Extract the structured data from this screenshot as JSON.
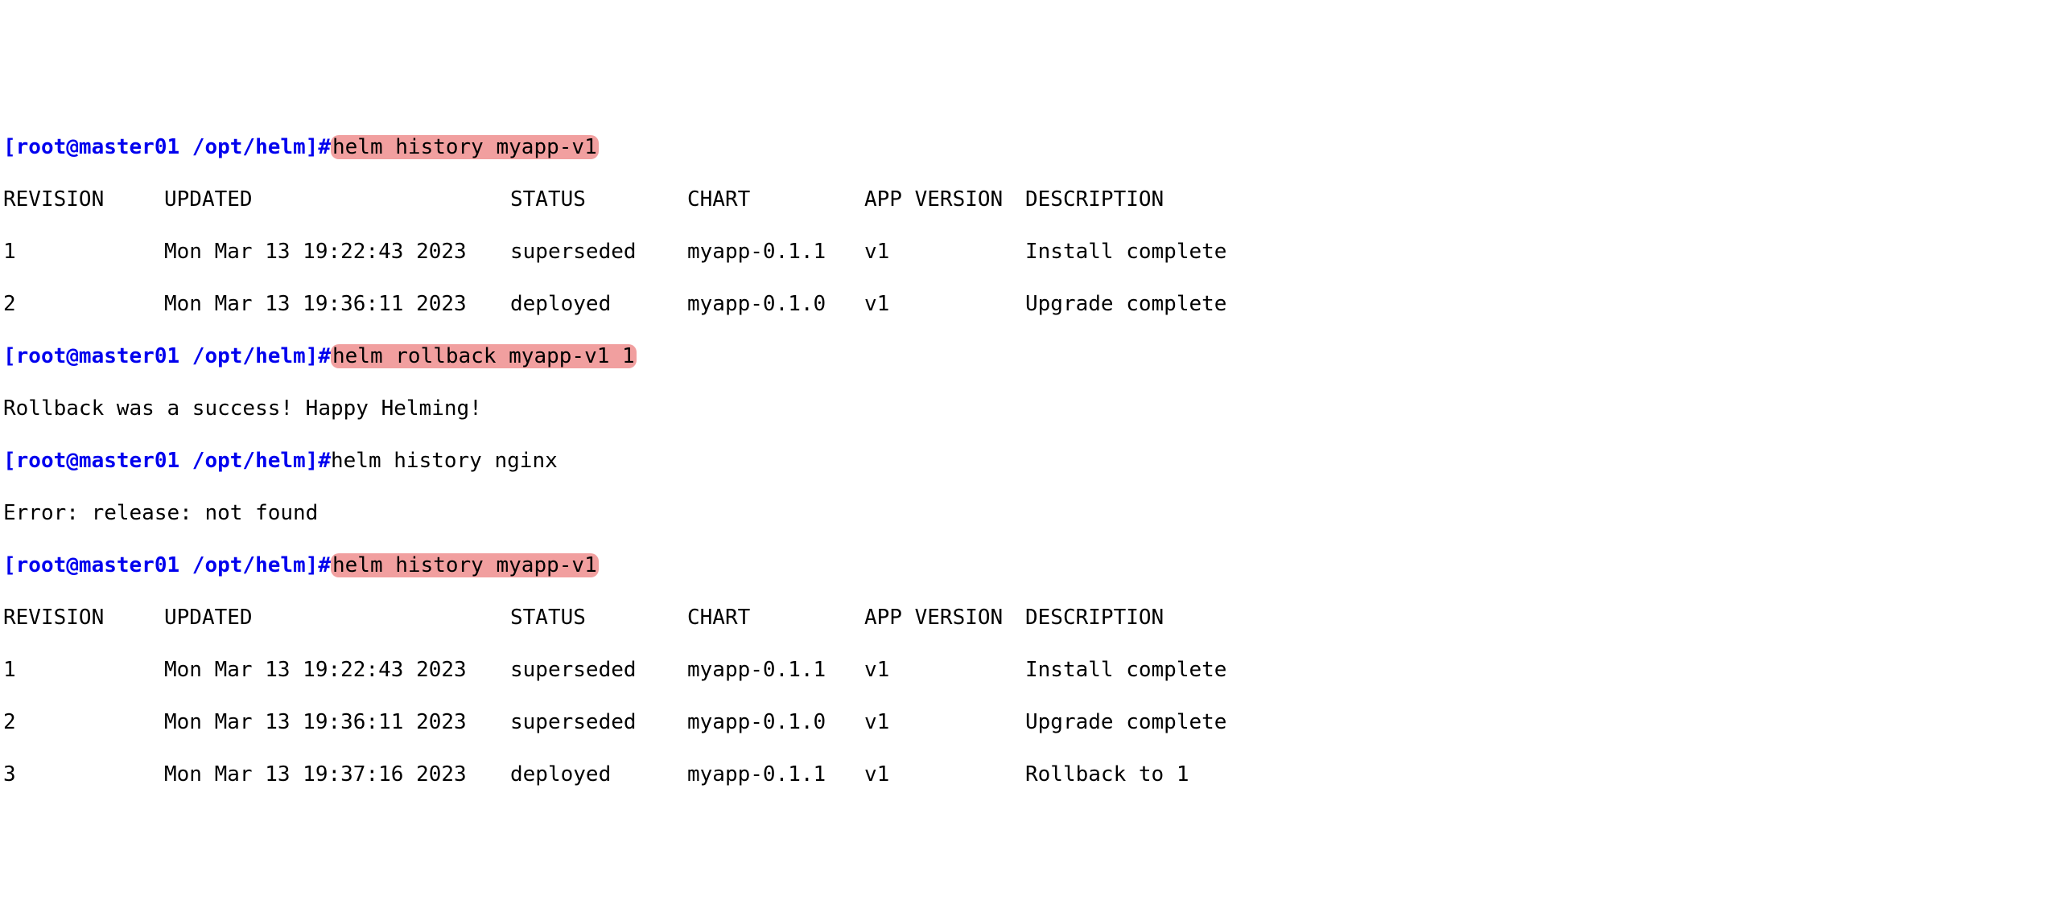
{
  "prompt": "[root@master01 /opt/helm]#",
  "cmd1": "helm history myapp-v1",
  "cmd2": "helm rollback myapp-v1 1",
  "cmd3": "helm history nginx",
  "cmd4": "helm history myapp-v1",
  "rollback_msg": "Rollback was a success! Happy Helming!",
  "error_msg": "Error: release: not found",
  "headers": {
    "revision": "REVISION",
    "updated": "UPDATED",
    "status": "STATUS",
    "chart": "CHART",
    "app_version": "APP VERSION",
    "description": "DESCRIPTION"
  },
  "table1": [
    {
      "rev": "1",
      "upd": "Mon Mar 13 19:22:43 2023",
      "stat": "superseded",
      "chart": "myapp-0.1.1",
      "ver": "v1",
      "desc": "Install complete"
    },
    {
      "rev": "2",
      "upd": "Mon Mar 13 19:36:11 2023",
      "stat": "deployed",
      "chart": "myapp-0.1.0",
      "ver": "v1",
      "desc": "Upgrade complete"
    }
  ],
  "table2": [
    {
      "rev": "1",
      "upd": "Mon Mar 13 19:22:43 2023",
      "stat": "superseded",
      "chart": "myapp-0.1.1",
      "ver": "v1",
      "desc": "Install complete"
    },
    {
      "rev": "2",
      "upd": "Mon Mar 13 19:36:11 2023",
      "stat": "superseded",
      "chart": "myapp-0.1.0",
      "ver": "v1",
      "desc": "Upgrade complete"
    },
    {
      "rev": "3",
      "upd": "Mon Mar 13 19:37:16 2023",
      "stat": "deployed",
      "chart": "myapp-0.1.1",
      "ver": "v1",
      "desc": "Rollback to 1"
    }
  ]
}
